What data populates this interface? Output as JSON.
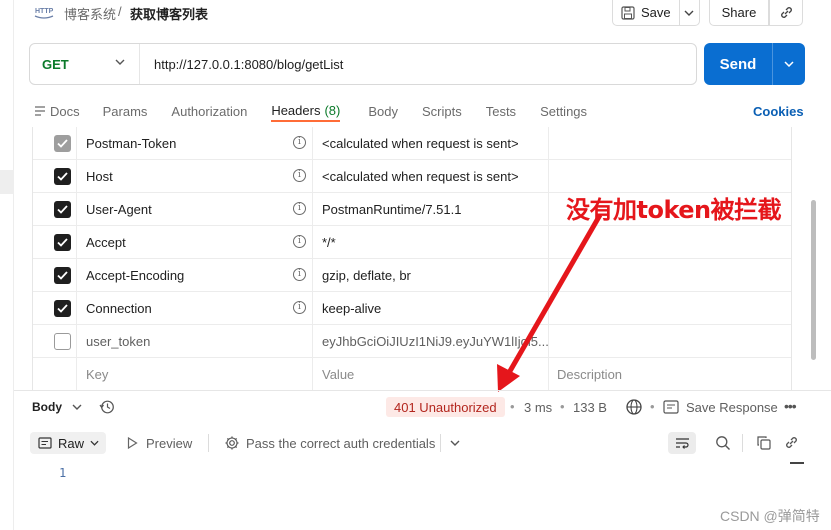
{
  "header": {
    "app_icon": "http-icon",
    "breadcrumb_parent": "博客系统",
    "breadcrumb_sep": "/",
    "title": "获取博客列表",
    "save_label": "Save",
    "share_label": "Share"
  },
  "request": {
    "method": "GET",
    "url": "http://127.0.0.1:8080/blog/getList",
    "send_label": "Send"
  },
  "tabs": [
    {
      "label": "Docs",
      "icon": "docs-icon"
    },
    {
      "label": "Params"
    },
    {
      "label": "Authorization"
    },
    {
      "label": "Headers",
      "count": "(8)",
      "active": true
    },
    {
      "label": "Body"
    },
    {
      "label": "Scripts"
    },
    {
      "label": "Tests"
    },
    {
      "label": "Settings"
    }
  ],
  "cookies_label": "Cookies",
  "headers_table": {
    "rows": [
      {
        "key": "Postman-Token",
        "value": "<calculated when request is sent>",
        "checked": "grey"
      },
      {
        "key": "Host",
        "value": "<calculated when request is sent>",
        "checked": "yes"
      },
      {
        "key": "User-Agent",
        "value": "PostmanRuntime/7.51.1",
        "checked": "yes"
      },
      {
        "key": "Accept",
        "value": "*/*",
        "checked": "yes"
      },
      {
        "key": "Accept-Encoding",
        "value": "gzip, deflate, br",
        "checked": "yes"
      },
      {
        "key": "Connection",
        "value": "keep-alive",
        "checked": "yes"
      },
      {
        "key": "user_token",
        "value": "eyJhbGciOiJIUzI1NiJ9.eyJuYW1lIjoi5...",
        "checked": "no"
      }
    ],
    "placeholder": {
      "key": "Key",
      "value": "Value",
      "description": "Description"
    }
  },
  "annotation": {
    "text": "没有加token被拦截",
    "color": "#e5161b"
  },
  "response": {
    "body_label": "Body",
    "status": "401 Unauthorized",
    "time": "3 ms",
    "size": "133 B",
    "save_response_label": "Save Response",
    "format_label": "Raw",
    "preview_label": "Preview",
    "auth_message": "Pass the correct auth credentials",
    "line_number": "1"
  },
  "watermark": "CSDN @弹简特",
  "colors": {
    "send": "#0a6ed1",
    "method_get": "#0b7a2a",
    "active_tab_underline": "#ff6c37",
    "status_error_bg": "#fde9e6",
    "status_error_text": "#b3261e"
  }
}
